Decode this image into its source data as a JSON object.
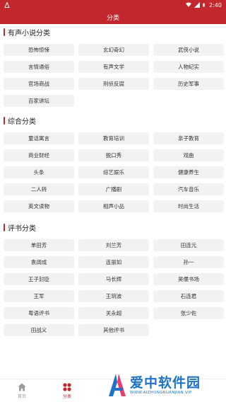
{
  "status_bar": {
    "time": "2:40",
    "bg": "#c2272d"
  },
  "header": {
    "title": "分类"
  },
  "sections": [
    {
      "title": "有声小说分类",
      "items": [
        "恐怖惊悚",
        "玄幻奇幻",
        "武侠小说",
        "言情通俗",
        "有声文学",
        "人物纪实",
        "官场商战",
        "刑侦反腐",
        "历史军事",
        "百家讲坛"
      ]
    },
    {
      "title": "综合分类",
      "items": [
        "童话寓言",
        "教育培训",
        "亲子教育",
        "商业财经",
        "脱口秀",
        "戏曲",
        "头条",
        "综艺娱乐",
        "健康养生",
        "二人转",
        "广播剧",
        "汽车音乐",
        "英文读物",
        "相声小品",
        "时尚生活"
      ]
    },
    {
      "title": "评书分类",
      "items": [
        "单田芳",
        "刘兰芳",
        "田连元",
        "袁阔成",
        "连丽如",
        "孙一",
        "王子封臣",
        "马长辉",
        "昊儒书场",
        "王军",
        "王玥波",
        "石连君",
        "粤语评书",
        "关永超",
        "张少佐",
        "田战义",
        "其他评书"
      ]
    }
  ],
  "bottom_nav": {
    "items": [
      {
        "label": "首页",
        "icon": "home-icon",
        "active": false
      },
      {
        "label": "分类",
        "icon": "category-icon",
        "active": true
      }
    ]
  },
  "watermark": {
    "cn": "爱中软件园",
    "en": "WWW.AIZHONGRUANJIAN.VIP"
  },
  "colors": {
    "accent": "#c2272d",
    "chip_bg": "#f2f2f2",
    "watermark": "#1e73c9"
  }
}
